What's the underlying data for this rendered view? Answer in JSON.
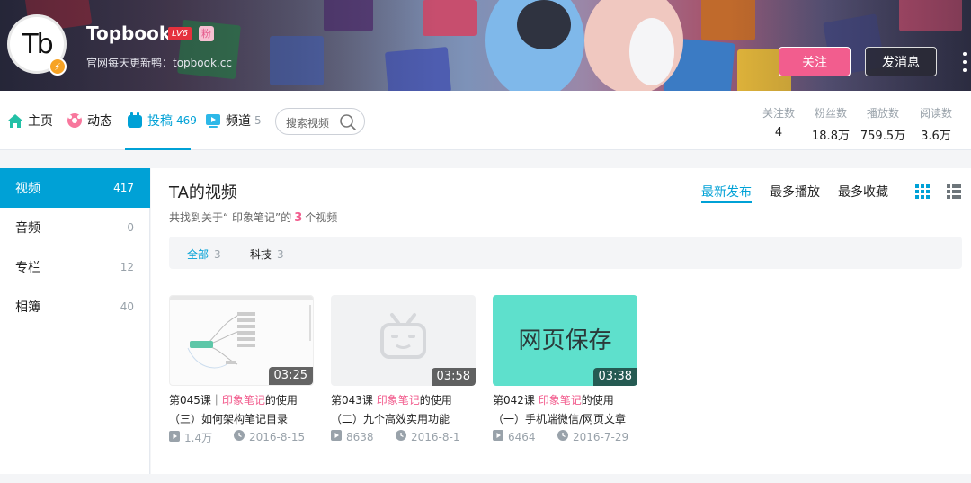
{
  "header": {
    "username": "Topbook",
    "level": "LV6",
    "fan_badge": "粉",
    "avatar_text": "Tb",
    "signature": "官网每天更新鸭：topbook.cc",
    "follow_label": "关注",
    "message_label": "发消息"
  },
  "nav": {
    "tabs": [
      {
        "label": "主页",
        "count": "",
        "icon": "home-icon"
      },
      {
        "label": "动态",
        "count": "",
        "icon": "dynamic-icon"
      },
      {
        "label": "投稿",
        "count": "469",
        "icon": "upload-icon"
      },
      {
        "label": "频道",
        "count": "5",
        "icon": "channel-icon"
      }
    ],
    "active_tab": "投稿",
    "search_placeholder": "搜索视频"
  },
  "stats": [
    {
      "label": "关注数",
      "value": "4"
    },
    {
      "label": "粉丝数",
      "value": "18.8万"
    },
    {
      "label": "播放数",
      "value": "759.5万"
    },
    {
      "label": "阅读数",
      "value": "3.6万"
    }
  ],
  "sidebar": {
    "items": [
      {
        "label": "视频",
        "count": "417"
      },
      {
        "label": "音频",
        "count": "0"
      },
      {
        "label": "专栏",
        "count": "12"
      },
      {
        "label": "相簿",
        "count": "40"
      }
    ]
  },
  "main": {
    "title": "TA的视频",
    "found_prefix": "共找到关于“ 印象笔记”的",
    "found_count": "3",
    "found_suffix": "个视频",
    "sort_options": [
      "最新发布",
      "最多播放",
      "最多收藏"
    ],
    "tags": [
      {
        "label": "全部",
        "count": "3"
      },
      {
        "label": "科技",
        "count": "3"
      }
    ]
  },
  "videos": [
    {
      "line1_prefix": "第045课｜",
      "highlight": "印象笔记",
      "line1_suffix": "的使用",
      "line2": "（三）如何架构笔记目录",
      "duration": "03:25",
      "plays": "1.4万",
      "date": "2016-8-15"
    },
    {
      "line1_prefix": "第043课 ",
      "highlight": "印象笔记",
      "line1_suffix": "的使用",
      "line2": "（二）九个高效实用功能",
      "duration": "03:58",
      "plays": "8638",
      "date": "2016-8-1"
    },
    {
      "line1_prefix": "第042课 ",
      "highlight": "印象笔记",
      "line1_suffix": "的使用",
      "line2": "（一）手机端微信/网页文章",
      "duration": "03:38",
      "plays": "6464",
      "date": "2016-7-29",
      "thumb_text": "网页保存"
    }
  ],
  "colors": {
    "accent": "#00a1d6",
    "pink": "#f25d8e",
    "thumb_teal": "#5ee0cc"
  }
}
